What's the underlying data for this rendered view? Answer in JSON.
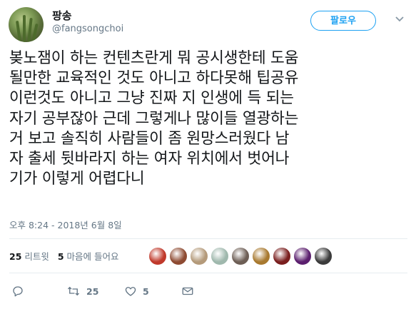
{
  "author": {
    "display_name": "팡송",
    "handle": "@fangsongchoi"
  },
  "follow_button_label": "팔로우",
  "tweet": {
    "lines": [
      "봊노잼이 하는 컨텐츠란게 뭐 공시생한테 도움",
      "될만한 교육적인 것도 아니고 하다못해 팁공유",
      "이런것도 아니고 그냥 진짜 지 인생에 득 되는",
      "자기 공부잖아 근데 그렇게나 많이들 열광하는",
      "거 보고 솔직히 사람들이 좀 원망스러웠다 남",
      "자 출세 뒷바라지 하는 여자 위치에서 벗어나",
      "기가 이렇게 어렵다니"
    ],
    "timestamp": "오후 8:24 - 2018년 6월 8일"
  },
  "stats": {
    "retweets_count": "25",
    "retweets_label": "리트윗",
    "likes_count": "5",
    "likes_label": "마음에 들어요"
  },
  "likers": [
    {
      "name": "liker-1",
      "color": "#c0392b"
    },
    {
      "name": "liker-2",
      "color": "#8e4b32"
    },
    {
      "name": "liker-3",
      "color": "#b49a7a"
    },
    {
      "name": "liker-4",
      "color": "#9fb8ad"
    },
    {
      "name": "liker-5",
      "color": "#6d5e55"
    },
    {
      "name": "liker-6",
      "color": "#a8792f"
    },
    {
      "name": "liker-7",
      "color": "#7a1f1f"
    },
    {
      "name": "liker-8",
      "color": "#5b1f6e"
    },
    {
      "name": "liker-9",
      "color": "#3b3b3b"
    }
  ],
  "actions": {
    "reply_icon": "reply-icon",
    "retweet_icon": "retweet-icon",
    "retweet_count": "25",
    "like_icon": "heart-icon",
    "like_count": "5",
    "dm_icon": "mail-icon"
  },
  "colors": {
    "accent": "#1da1f2",
    "secondary_text": "#657786",
    "divider": "#e6ecf0"
  }
}
